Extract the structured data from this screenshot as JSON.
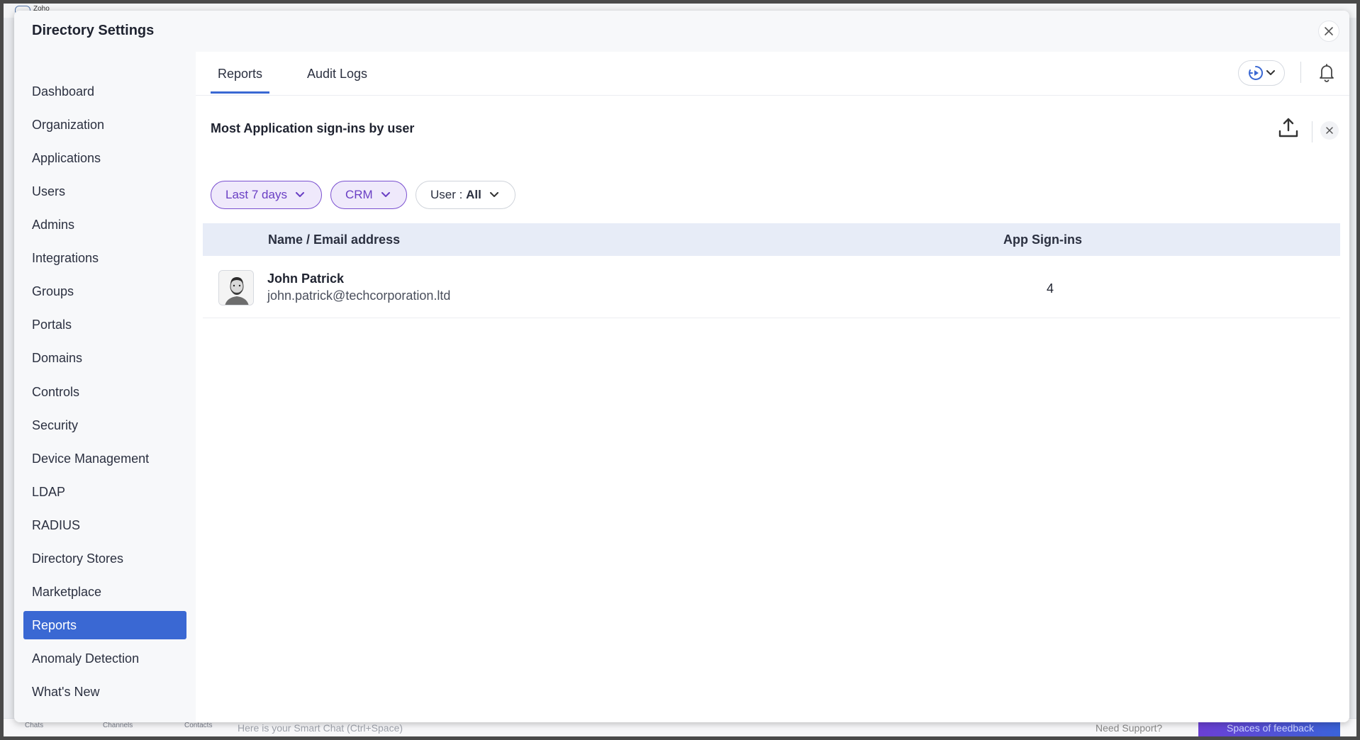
{
  "background": {
    "app_name": "Zoho",
    "bottom_nav": [
      "Chats",
      "Channels",
      "Contacts"
    ],
    "chat_placeholder": "Here is your Smart Chat (Ctrl+Space)",
    "support_label": "Need Support?",
    "feedback_label": "Spaces of feedback"
  },
  "modal": {
    "title": "Directory Settings",
    "close_icon": "close-icon"
  },
  "sidebar": {
    "items": [
      {
        "label": "Dashboard"
      },
      {
        "label": "Organization"
      },
      {
        "label": "Applications"
      },
      {
        "label": "Users"
      },
      {
        "label": "Admins"
      },
      {
        "label": "Integrations"
      },
      {
        "label": "Groups"
      },
      {
        "label": "Portals"
      },
      {
        "label": "Domains"
      },
      {
        "label": "Controls"
      },
      {
        "label": "Security"
      },
      {
        "label": "Device Management"
      },
      {
        "label": "LDAP"
      },
      {
        "label": "RADIUS"
      },
      {
        "label": "Directory Stores"
      },
      {
        "label": "Marketplace"
      },
      {
        "label": "Reports",
        "active": true
      },
      {
        "label": "Anomaly Detection"
      },
      {
        "label": "What's New"
      }
    ]
  },
  "tabs": [
    {
      "label": "Reports",
      "active": true
    },
    {
      "label": "Audit Logs"
    }
  ],
  "report": {
    "title": "Most Application sign-ins by user",
    "filters": {
      "period": "Last 7 days",
      "app": "CRM",
      "user_prefix": "User : ",
      "user_value": "All"
    },
    "table": {
      "columns": [
        "Name / Email address",
        "App Sign-ins"
      ],
      "rows": [
        {
          "name": "John Patrick",
          "email": "john.patrick@techcorporation.ltd",
          "signins": "4"
        }
      ]
    }
  },
  "colors": {
    "accent": "#3a68d3",
    "filter_purple": "#6a3fc4",
    "table_header_bg": "#e7ecf7"
  }
}
